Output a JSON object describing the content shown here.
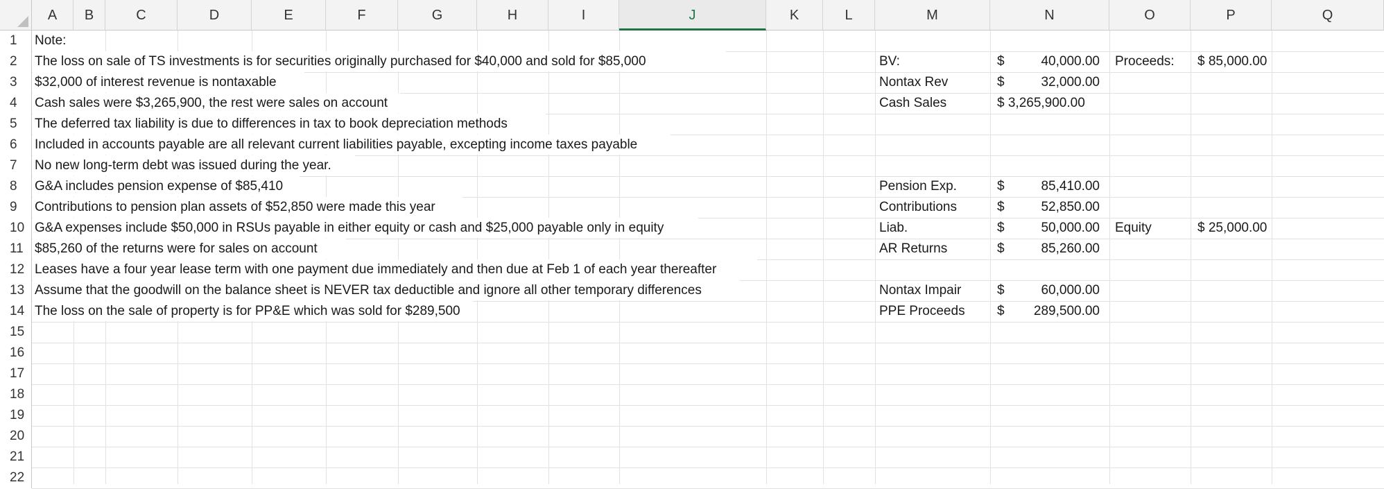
{
  "sheet": {
    "columns": [
      "A",
      "B",
      "C",
      "D",
      "E",
      "F",
      "G",
      "H",
      "I",
      "J",
      "K",
      "L",
      "M",
      "N",
      "O",
      "P",
      "Q"
    ],
    "selected_column": "J",
    "rows": [
      "1",
      "2",
      "3",
      "4",
      "5",
      "6",
      "7",
      "8",
      "9",
      "10",
      "11",
      "12",
      "13",
      "14",
      "15",
      "16",
      "17",
      "18",
      "19",
      "20",
      "21",
      "22"
    ]
  },
  "notes": [
    "Note:",
    "The loss on sale of TS investments is for securities originally purchased for $40,000 and sold for $85,000",
    "$32,000 of interest revenue is nontaxable",
    "Cash sales were $3,265,900, the rest were sales on account",
    "The deferred tax liability is due to differences in tax to book depreciation methods",
    "Included in accounts payable are all relevant current liabilities payable, excepting income taxes payable",
    "No new long-term debt was issued during the year.",
    "G&A includes pension expense of $85,410",
    "Contributions to pension plan assets of $52,850 were made this year",
    "G&A expenses include $50,000 in RSUs payable in either equity or cash and $25,000 payable only in equity",
    "$85,260 of the returns were for sales on account",
    "Leases have a four year lease term with one payment due immediately and then due at Feb 1 of each year thereafter",
    "Assume that the goodwill on the balance sheet is NEVER tax deductible and ignore all other temporary differences",
    "The loss on the sale of property is for PP&E which was sold for $289,500"
  ],
  "side": {
    "r2": {
      "label": "BV:",
      "cur": "$",
      "amount": "40,000.00",
      "o": "Proceeds:",
      "p": "$ 85,000.00"
    },
    "r3": {
      "label": "Nontax Rev",
      "cur": "$",
      "amount": "32,000.00"
    },
    "r4": {
      "label": "Cash Sales",
      "amount": "$ 3,265,900.00"
    },
    "r8": {
      "label": "Pension Exp.",
      "cur": "$",
      "amount": "85,410.00"
    },
    "r9": {
      "label": "Contributions",
      "cur": "$",
      "amount": "52,850.00"
    },
    "r10": {
      "label": "Liab.",
      "cur": "$",
      "amount": "50,000.00",
      "o": "Equity",
      "p": "$ 25,000.00"
    },
    "r11": {
      "label": "AR Returns",
      "cur": "$",
      "amount": "85,260.00"
    },
    "r13": {
      "label": "Nontax Impair",
      "cur": "$",
      "amount": "60,000.00"
    },
    "r14": {
      "label": "PPE Proceeds",
      "cur": "$",
      "amount": "289,500.00"
    }
  }
}
